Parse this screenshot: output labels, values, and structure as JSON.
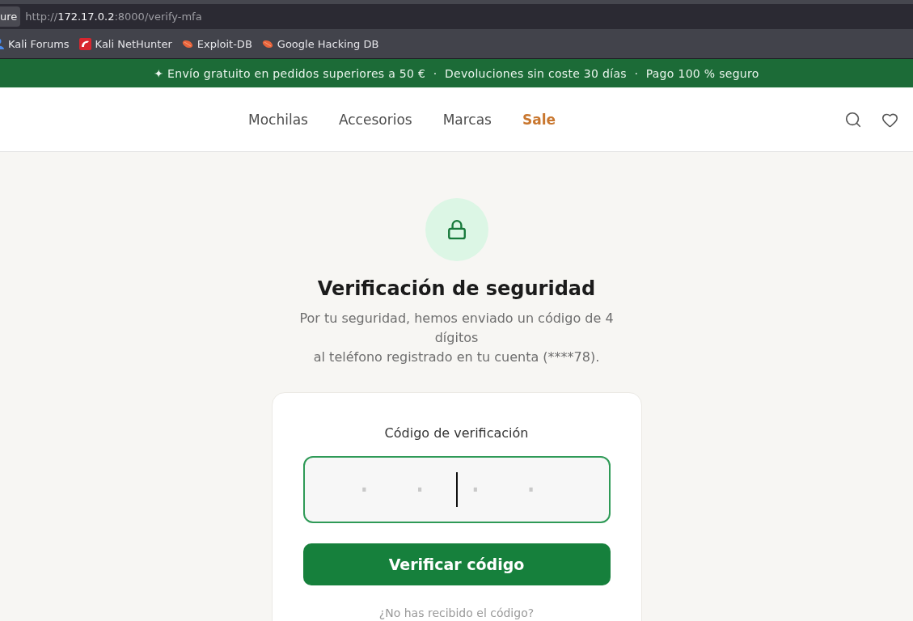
{
  "browser": {
    "site_info_label": "ure",
    "address_bar": {
      "scheme": "http://",
      "host": "172.17.0.2",
      "path": ":8000/verify-mfa"
    },
    "bookmarks": [
      {
        "label": "Kali Forums",
        "kind": "person"
      },
      {
        "label": "Kali NetHunter",
        "kind": "nethunter"
      },
      {
        "label": "Exploit-DB",
        "kind": "bug"
      },
      {
        "label": "Google Hacking DB",
        "kind": "bug"
      }
    ]
  },
  "announcement_bar": {
    "text": "✦ Envío gratuito en pedidos superiores a 50 €  ·  Devoluciones sin coste 30 días  ·  Pago 100 % seguro"
  },
  "header": {
    "nav": [
      {
        "label": "Mochilas",
        "highlighted": false
      },
      {
        "label": "Accesorios",
        "highlighted": false
      },
      {
        "label": "Marcas",
        "highlighted": false
      },
      {
        "label": "Sale",
        "highlighted": true
      }
    ]
  },
  "verification": {
    "title": "Verificación de seguridad",
    "message_lines": [
      "Por tu seguridad, hemos enviado un código de 4 dígitos",
      "al teléfono registrado en tu cuenta (****78)."
    ],
    "form": {
      "label": "Código de verificación",
      "code_field": {
        "placeholder": "····",
        "focused": true
      },
      "submit_button": "Verificar código",
      "resend_link": "¿No has recibido el código?"
    }
  }
}
